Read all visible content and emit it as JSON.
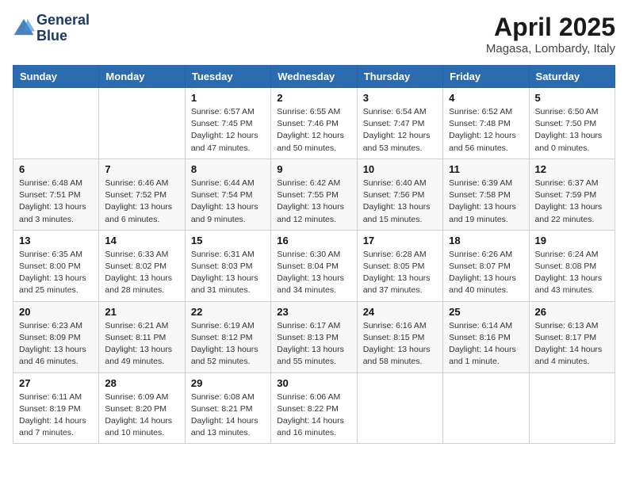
{
  "header": {
    "logo_line1": "General",
    "logo_line2": "Blue",
    "month_title": "April 2025",
    "location": "Magasa, Lombardy, Italy"
  },
  "weekdays": [
    "Sunday",
    "Monday",
    "Tuesday",
    "Wednesday",
    "Thursday",
    "Friday",
    "Saturday"
  ],
  "weeks": [
    [
      {
        "day": "",
        "detail": ""
      },
      {
        "day": "",
        "detail": ""
      },
      {
        "day": "1",
        "detail": "Sunrise: 6:57 AM\nSunset: 7:45 PM\nDaylight: 12 hours and 47 minutes."
      },
      {
        "day": "2",
        "detail": "Sunrise: 6:55 AM\nSunset: 7:46 PM\nDaylight: 12 hours and 50 minutes."
      },
      {
        "day": "3",
        "detail": "Sunrise: 6:54 AM\nSunset: 7:47 PM\nDaylight: 12 hours and 53 minutes."
      },
      {
        "day": "4",
        "detail": "Sunrise: 6:52 AM\nSunset: 7:48 PM\nDaylight: 12 hours and 56 minutes."
      },
      {
        "day": "5",
        "detail": "Sunrise: 6:50 AM\nSunset: 7:50 PM\nDaylight: 13 hours and 0 minutes."
      }
    ],
    [
      {
        "day": "6",
        "detail": "Sunrise: 6:48 AM\nSunset: 7:51 PM\nDaylight: 13 hours and 3 minutes."
      },
      {
        "day": "7",
        "detail": "Sunrise: 6:46 AM\nSunset: 7:52 PM\nDaylight: 13 hours and 6 minutes."
      },
      {
        "day": "8",
        "detail": "Sunrise: 6:44 AM\nSunset: 7:54 PM\nDaylight: 13 hours and 9 minutes."
      },
      {
        "day": "9",
        "detail": "Sunrise: 6:42 AM\nSunset: 7:55 PM\nDaylight: 13 hours and 12 minutes."
      },
      {
        "day": "10",
        "detail": "Sunrise: 6:40 AM\nSunset: 7:56 PM\nDaylight: 13 hours and 15 minutes."
      },
      {
        "day": "11",
        "detail": "Sunrise: 6:39 AM\nSunset: 7:58 PM\nDaylight: 13 hours and 19 minutes."
      },
      {
        "day": "12",
        "detail": "Sunrise: 6:37 AM\nSunset: 7:59 PM\nDaylight: 13 hours and 22 minutes."
      }
    ],
    [
      {
        "day": "13",
        "detail": "Sunrise: 6:35 AM\nSunset: 8:00 PM\nDaylight: 13 hours and 25 minutes."
      },
      {
        "day": "14",
        "detail": "Sunrise: 6:33 AM\nSunset: 8:02 PM\nDaylight: 13 hours and 28 minutes."
      },
      {
        "day": "15",
        "detail": "Sunrise: 6:31 AM\nSunset: 8:03 PM\nDaylight: 13 hours and 31 minutes."
      },
      {
        "day": "16",
        "detail": "Sunrise: 6:30 AM\nSunset: 8:04 PM\nDaylight: 13 hours and 34 minutes."
      },
      {
        "day": "17",
        "detail": "Sunrise: 6:28 AM\nSunset: 8:05 PM\nDaylight: 13 hours and 37 minutes."
      },
      {
        "day": "18",
        "detail": "Sunrise: 6:26 AM\nSunset: 8:07 PM\nDaylight: 13 hours and 40 minutes."
      },
      {
        "day": "19",
        "detail": "Sunrise: 6:24 AM\nSunset: 8:08 PM\nDaylight: 13 hours and 43 minutes."
      }
    ],
    [
      {
        "day": "20",
        "detail": "Sunrise: 6:23 AM\nSunset: 8:09 PM\nDaylight: 13 hours and 46 minutes."
      },
      {
        "day": "21",
        "detail": "Sunrise: 6:21 AM\nSunset: 8:11 PM\nDaylight: 13 hours and 49 minutes."
      },
      {
        "day": "22",
        "detail": "Sunrise: 6:19 AM\nSunset: 8:12 PM\nDaylight: 13 hours and 52 minutes."
      },
      {
        "day": "23",
        "detail": "Sunrise: 6:17 AM\nSunset: 8:13 PM\nDaylight: 13 hours and 55 minutes."
      },
      {
        "day": "24",
        "detail": "Sunrise: 6:16 AM\nSunset: 8:15 PM\nDaylight: 13 hours and 58 minutes."
      },
      {
        "day": "25",
        "detail": "Sunrise: 6:14 AM\nSunset: 8:16 PM\nDaylight: 14 hours and 1 minute."
      },
      {
        "day": "26",
        "detail": "Sunrise: 6:13 AM\nSunset: 8:17 PM\nDaylight: 14 hours and 4 minutes."
      }
    ],
    [
      {
        "day": "27",
        "detail": "Sunrise: 6:11 AM\nSunset: 8:19 PM\nDaylight: 14 hours and 7 minutes."
      },
      {
        "day": "28",
        "detail": "Sunrise: 6:09 AM\nSunset: 8:20 PM\nDaylight: 14 hours and 10 minutes."
      },
      {
        "day": "29",
        "detail": "Sunrise: 6:08 AM\nSunset: 8:21 PM\nDaylight: 14 hours and 13 minutes."
      },
      {
        "day": "30",
        "detail": "Sunrise: 6:06 AM\nSunset: 8:22 PM\nDaylight: 14 hours and 16 minutes."
      },
      {
        "day": "",
        "detail": ""
      },
      {
        "day": "",
        "detail": ""
      },
      {
        "day": "",
        "detail": ""
      }
    ]
  ]
}
